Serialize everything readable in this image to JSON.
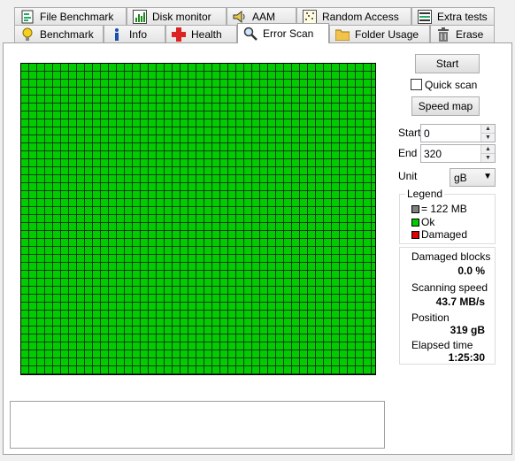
{
  "tabs": {
    "row1": [
      {
        "label": "File Benchmark",
        "icon": "file-benchmark-icon"
      },
      {
        "label": "Disk monitor",
        "icon": "disk-monitor-icon"
      },
      {
        "label": "AAM",
        "icon": "speaker-icon"
      },
      {
        "label": "Random Access",
        "icon": "random-access-icon"
      },
      {
        "label": "Extra tests",
        "icon": "extra-tests-icon"
      }
    ],
    "row2": [
      {
        "label": "Benchmark",
        "icon": "lightbulb-icon"
      },
      {
        "label": "Info",
        "icon": "info-icon"
      },
      {
        "label": "Health",
        "icon": "health-cross-icon"
      },
      {
        "label": "Error Scan",
        "icon": "magnifier-icon",
        "active": true
      },
      {
        "label": "Folder Usage",
        "icon": "folder-icon"
      },
      {
        "label": "Erase",
        "icon": "trash-icon"
      }
    ]
  },
  "controls": {
    "start_button": "Start",
    "quick_scan_label": "Quick scan",
    "quick_scan_checked": false,
    "speed_map_button": "Speed map",
    "start_label": "Start",
    "start_value": "0",
    "end_label": "End",
    "end_value": "320",
    "unit_label": "Unit",
    "unit_value": "gB"
  },
  "legend": {
    "title": "Legend",
    "block_size": "= 122 MB",
    "ok_label": "Ok",
    "damaged_label": "Damaged",
    "colors": {
      "block": "#808080",
      "ok": "#00cc00",
      "damaged": "#e00000"
    }
  },
  "stats": {
    "damaged_blocks_label": "Damaged blocks",
    "damaged_blocks_value": "0.0 %",
    "scanning_speed_label": "Scanning speed",
    "scanning_speed_value": "43.7 MB/s",
    "position_label": "Position",
    "position_value": "319 gB",
    "elapsed_label": "Elapsed time",
    "elapsed_value": "1:25:30"
  },
  "map": {
    "status": "all blocks ok",
    "ok_color": "#00cc00"
  },
  "log": {
    "text": ""
  }
}
